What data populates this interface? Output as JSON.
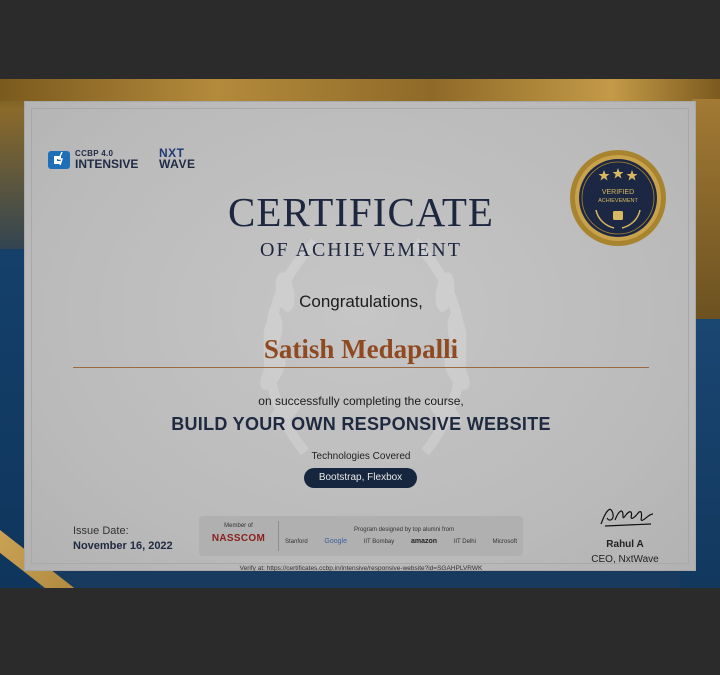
{
  "logos": {
    "ccbp_line1": "CCBP 4.0",
    "ccbp_line2": "INTENSIVE",
    "nxt_line1": "NXT",
    "nxt_line2": "WAVE"
  },
  "badge": {
    "line1": "VERIFIED",
    "line2": "ACHIEVEMENT",
    "colors": {
      "ring": "#a8842f",
      "inner": "#1c2744",
      "star": "#d8b860"
    }
  },
  "certificate": {
    "title": "CERTIFICATE",
    "subtitle": "OF ACHIEVEMENT",
    "congratulations": "Congratulations,",
    "recipient": "Satish Medapalli",
    "completion_text": "on successfully completing the course,",
    "course": "BUILD YOUR OWN RESPONSIVE WEBSITE",
    "technologies_label": "Technologies Covered",
    "technologies": "Bootstrap, Flexbox"
  },
  "issue": {
    "label": "Issue Date:",
    "date": "November 16, 2022"
  },
  "partners": {
    "member_label": "Member of",
    "member": "NASSCOM",
    "program_label": "Program designed by top alumni from",
    "orgs": [
      "Stanford",
      "Google",
      "IIT Bombay",
      "amazon",
      "IIT Delhi",
      "Microsoft"
    ]
  },
  "verify": "Verify at: https://certificates.ccbp.in/intensive/responsive-website?id=SGAHPLVRWK",
  "signatory": {
    "name": "Rahul A",
    "role": "CEO, NxtWave"
  },
  "colors": {
    "accent_navy": "#1e2740",
    "recipient": "#8f4a22",
    "gold": "#b48a3c",
    "blue": "#173a5e"
  }
}
